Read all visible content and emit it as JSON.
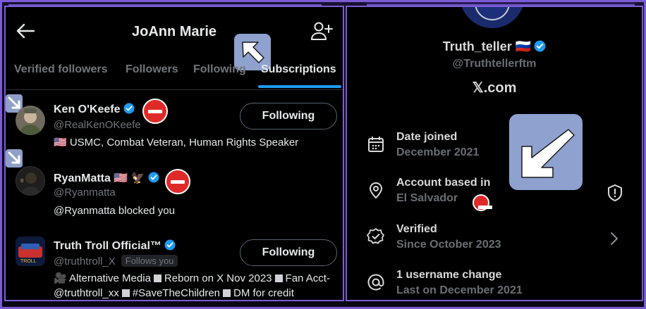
{
  "left": {
    "title": "JoAnn Marie",
    "tabs": [
      {
        "label": "Verified followers"
      },
      {
        "label": "Followers"
      },
      {
        "label": "Following"
      },
      {
        "label": "Subscriptions",
        "active": true
      }
    ],
    "users": [
      {
        "name": "Ken O'Keefe",
        "handle": "@RealKenOKeefe",
        "bio": "🇺🇸 USMC, Combat Veteran, Human Rights Speaker",
        "button": "Following"
      },
      {
        "name": "RyanMatta 🇺🇸 🦅",
        "handle": "@Ryanmatta",
        "bio": "@Ryanmatta blocked you"
      },
      {
        "name": "Truth Troll Official™",
        "handle": "@truthtroll_X",
        "follows_you": "Follows you",
        "bio_parts": [
          "🎥 Alternative Media",
          "Reborn on X Nov 2023",
          "Fan Acct-@truthtroll_xx",
          "#SaveTheChildren",
          "DM for credit"
        ],
        "button": "Following"
      }
    ]
  },
  "right": {
    "name": "Truth_teller 🇷🇺",
    "handle": "@Truthtellerftm",
    "site": "𝕏.com",
    "info": [
      {
        "title": "Date joined",
        "sub": "December 2021",
        "icon": "calendar-icon"
      },
      {
        "title": "Account based in",
        "sub": "El Salvador",
        "icon": "location-pin-icon"
      },
      {
        "title": "Verified",
        "sub": "Since October 2023",
        "icon": "verified-badge-icon"
      },
      {
        "title": "1 username change",
        "sub": "Last on December 2021",
        "icon": "at-sign-icon"
      }
    ]
  },
  "colors": {
    "accent_blue": "#1d9bf0",
    "frame_purple": "#7b5cd6",
    "stop_red": "#e02a2a",
    "arrow_overlay": "#8ea1cf"
  }
}
